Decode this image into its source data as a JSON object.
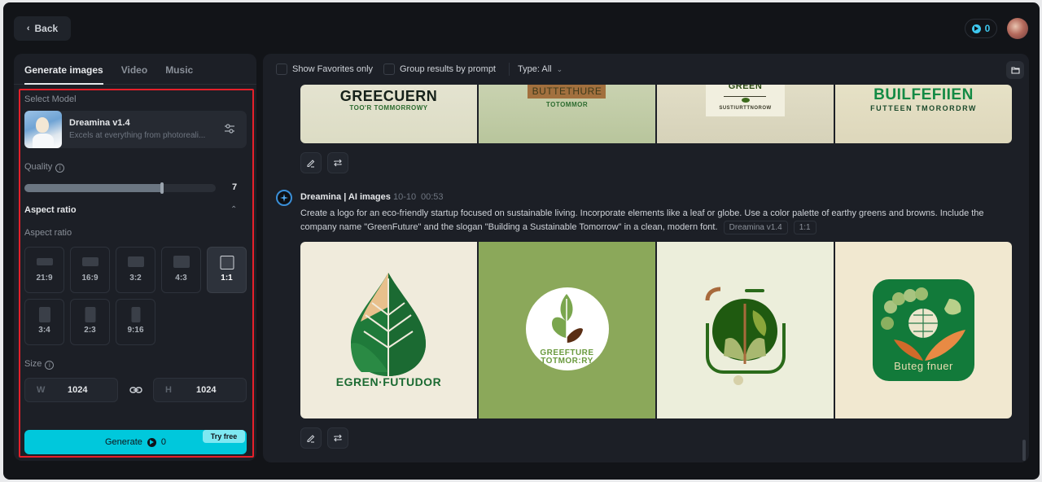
{
  "header": {
    "back_label": "Back",
    "credits": "0",
    "colors": {
      "accent": "#00c8dc",
      "credit": "#3ec8ef",
      "highlight": "#e5202a"
    }
  },
  "left_panel": {
    "tabs": [
      {
        "label": "Generate images",
        "active": true
      },
      {
        "label": "Video",
        "active": false
      },
      {
        "label": "Music",
        "active": false
      }
    ],
    "select_model_label": "Select Model",
    "model": {
      "name": "Dreamina v1.4",
      "description": "Excels at everything from photoreali..."
    },
    "quality": {
      "label": "Quality",
      "value": "7",
      "fraction": 0.72
    },
    "aspect_ratio_section": "Aspect ratio",
    "aspect_ratio_label": "Aspect ratio",
    "aspect_ratios": [
      {
        "label": "21:9",
        "selected": false
      },
      {
        "label": "16:9",
        "selected": false
      },
      {
        "label": "3:2",
        "selected": false
      },
      {
        "label": "4:3",
        "selected": false
      },
      {
        "label": "1:1",
        "selected": true
      },
      {
        "label": "3:4",
        "selected": false
      },
      {
        "label": "2:3",
        "selected": false
      },
      {
        "label": "9:16",
        "selected": false
      }
    ],
    "size": {
      "label": "Size",
      "width_prefix": "W",
      "width": "1024",
      "height_prefix": "H",
      "height": "1024"
    },
    "generate": {
      "label": "Generate",
      "cost": "0",
      "badge": "Try free"
    }
  },
  "right_panel": {
    "filters": {
      "favorites_label": "Show Favorites only",
      "group_label": "Group results by prompt",
      "type_label": "Type: All"
    },
    "top_images": [
      {
        "title": "GRΕΕCUERN",
        "subtitle": "TOO'R   TOMMORROWY"
      },
      {
        "title": "BUTTETHURE",
        "subtitle": "TOTOMMOR"
      },
      {
        "title": "GREEN",
        "subtitle": "SUSTIURTTNOROW"
      },
      {
        "title": "BUILFEFIIEN",
        "subtitle": "FUTTEEN TMORORDRW"
      }
    ],
    "generation": {
      "author": "Dreamina | AI images",
      "date": "10-10",
      "time": "00:53",
      "prompt": "Create a logo for an eco-friendly startup focused on sustainable living. Incorporate elements like a leaf or globe. Use a color palette of earthy greens and browns. Include the company name \"GreenFuture\" and the slogan \"Building a Sustainable Tomorrow\" in a clean, modern font.",
      "model_tag": "Dreamina v1.4",
      "ratio_tag": "1:1",
      "images": [
        {
          "caption": "EGREN·FUTUDOR"
        },
        {
          "caption": "GREEFTURE",
          "caption2": "TOTMOR:RY"
        },
        {
          "caption": ""
        },
        {
          "caption": "Buteg fnuer"
        }
      ]
    }
  }
}
